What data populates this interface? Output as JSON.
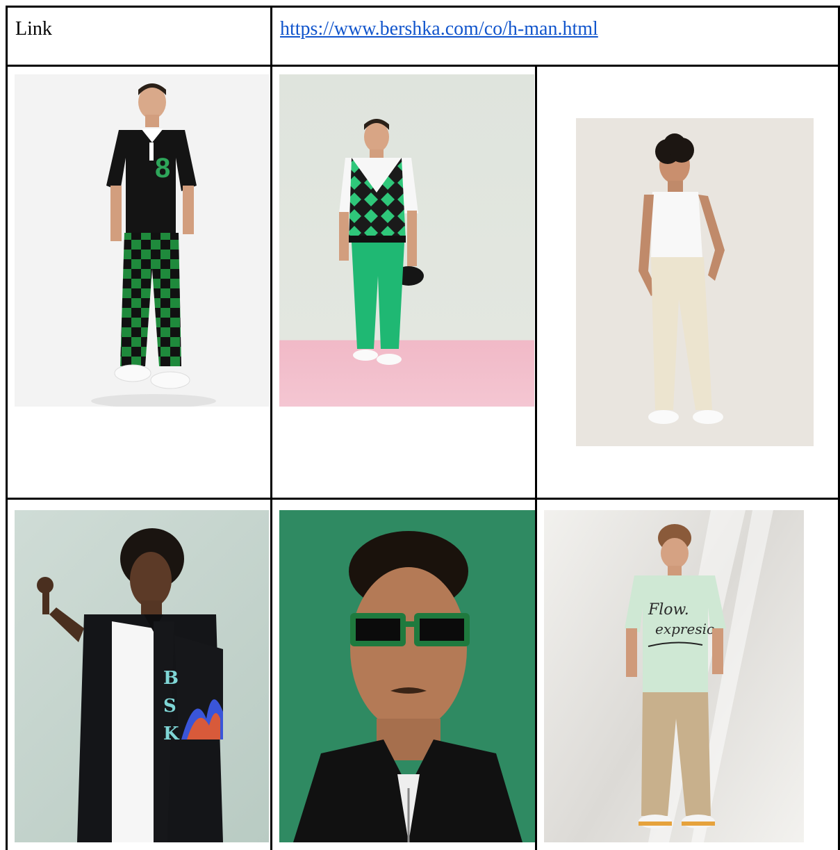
{
  "table": {
    "link_label": "Link",
    "link_url": "https://www.bershka.com/co/h-man.html"
  },
  "photos": [
    {
      "name": "model-checkered-pants-photo",
      "alt": ""
    },
    {
      "name": "model-argyle-vest-photo",
      "alt": ""
    },
    {
      "name": "model-tank-top-photo",
      "alt": ""
    },
    {
      "name": "model-black-shirt-photo",
      "alt": ""
    },
    {
      "name": "model-sunglasses-portrait-photo",
      "alt": ""
    },
    {
      "name": "model-graphic-tee-photo",
      "alt": ""
    }
  ],
  "colors": {
    "border": "#000000",
    "link": "#1155cc"
  }
}
